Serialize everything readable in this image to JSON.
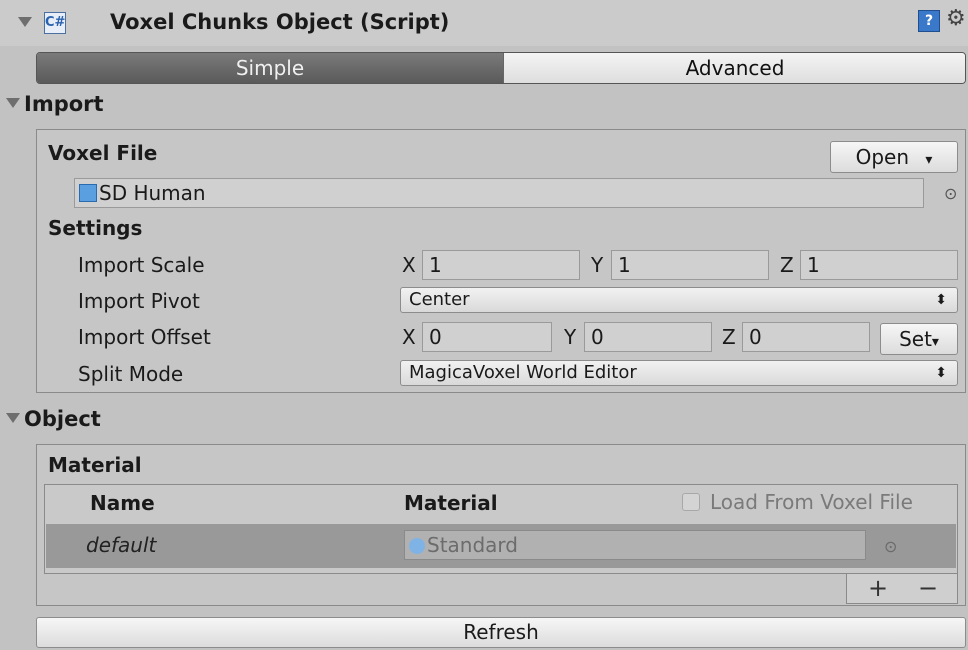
{
  "header": {
    "title": "Voxel Chunks Object (Script)",
    "script_icon": "cs-script-icon",
    "help_icon": "?",
    "gear_icon": "⚙"
  },
  "tabs": {
    "simple": "Simple",
    "advanced": "Advanced",
    "selected": "Simple"
  },
  "import": {
    "title": "Import",
    "voxel_file_label": "Voxel File",
    "open_button": "Open",
    "voxel_file_value": "SD Human",
    "settings_label": "Settings",
    "import_scale": {
      "label": "Import Scale",
      "x": "1",
      "y": "1",
      "z": "1"
    },
    "import_pivot": {
      "label": "Import Pivot",
      "value": "Center"
    },
    "import_offset": {
      "label": "Import Offset",
      "x": "0",
      "y": "0",
      "z": "0",
      "set_button": "Set"
    },
    "split_mode": {
      "label": "Split Mode",
      "value": "MagicaVoxel World Editor"
    }
  },
  "object": {
    "title": "Object",
    "material_label": "Material",
    "columns": {
      "name": "Name",
      "material": "Material"
    },
    "load_from_voxel_file": {
      "label": "Load From Voxel File",
      "checked": false
    },
    "rows": [
      {
        "name": "default",
        "material": "Standard"
      }
    ],
    "add_button": "+",
    "remove_button": "−"
  },
  "refresh_button": "Refresh",
  "axes": {
    "x": "X",
    "y": "Y",
    "z": "Z"
  }
}
